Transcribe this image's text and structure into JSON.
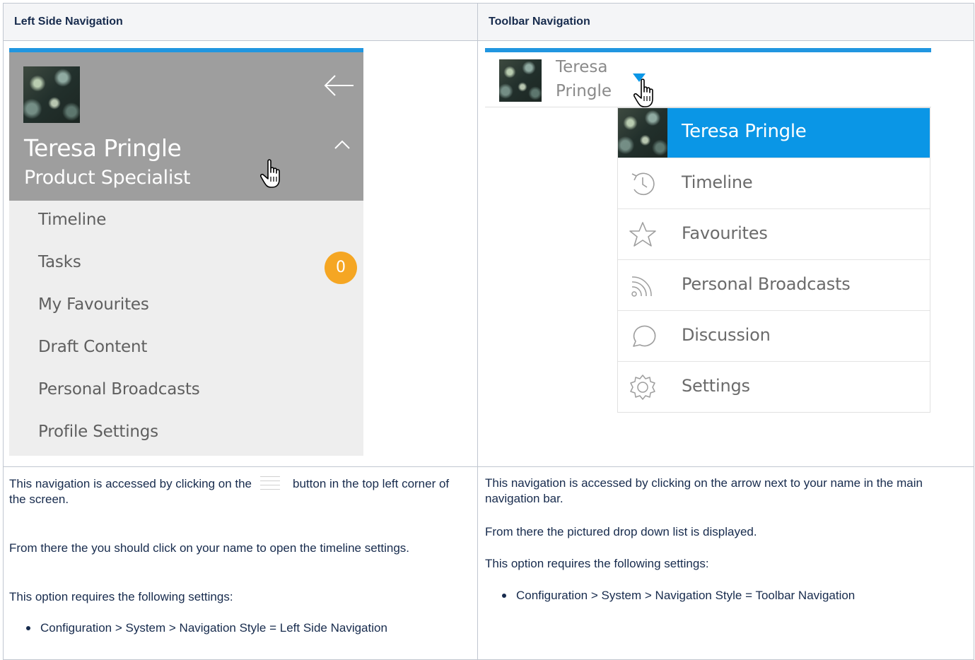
{
  "table": {
    "headers": [
      "Left Side Navigation",
      "Toolbar Navigation"
    ]
  },
  "left_nav": {
    "user_name": "Teresa Pringle",
    "user_role": "Product Specialist",
    "items": [
      {
        "label": "Timeline"
      },
      {
        "label": "Tasks",
        "badge": "0"
      },
      {
        "label": "My Favourites"
      },
      {
        "label": "Draft Content"
      },
      {
        "label": "Personal Broadcasts"
      },
      {
        "label": "Profile Settings"
      }
    ],
    "colors": {
      "accent": "#2196e0",
      "profile_bg": "#9e9e9e",
      "menu_bg": "#eeeeee",
      "badge": "#f5a623"
    }
  },
  "toolbar_nav": {
    "first_name": "Teresa",
    "last_name": "Pringle",
    "dropdown_header": "Teresa Pringle",
    "items": [
      {
        "label": "Timeline",
        "icon": "history-icon"
      },
      {
        "label": "Favourites",
        "icon": "star-icon"
      },
      {
        "label": "Personal Broadcasts",
        "icon": "rss-icon"
      },
      {
        "label": "Discussion",
        "icon": "chat-bubble-icon"
      },
      {
        "label": "Settings",
        "icon": "gear-icon"
      }
    ],
    "colors": {
      "accent": "#0a96e6"
    }
  },
  "left_desc": {
    "p1_before": "This navigation is accessed by clicking on the",
    "p1_after": "button in the top left corner of the screen.",
    "p2": "From there the you should click on your name to open the timeline settings.",
    "p3": "This option requires the following settings:",
    "bullet": "Configuration > System > Navigation Style = Left Side Navigation"
  },
  "right_desc": {
    "p1": "This navigation is accessed by clicking on the arrow next to your name in the main navigation bar.",
    "p2": "From there the pictured drop down list is displayed.",
    "p3": "This option requires the following settings:",
    "bullet": "Configuration > System > Navigation Style = Toolbar Navigation"
  }
}
